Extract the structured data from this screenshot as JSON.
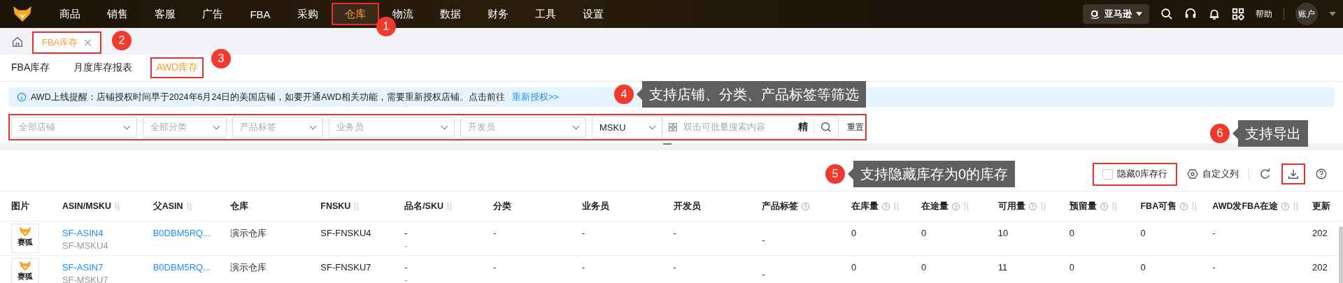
{
  "nav": {
    "items": [
      {
        "label": "商品",
        "selected": false,
        "highlighted": false
      },
      {
        "label": "销售",
        "selected": false,
        "highlighted": false
      },
      {
        "label": "客服",
        "selected": false,
        "highlighted": false
      },
      {
        "label": "广告",
        "selected": false,
        "highlighted": false
      },
      {
        "label": "FBA",
        "selected": false,
        "highlighted": false
      },
      {
        "label": "采购",
        "selected": false,
        "highlighted": false
      },
      {
        "label": "仓库",
        "selected": true,
        "highlighted": true
      },
      {
        "label": "物流",
        "selected": false,
        "highlighted": false
      },
      {
        "label": "数据",
        "selected": false,
        "highlighted": false
      },
      {
        "label": "财务",
        "selected": false,
        "highlighted": false
      },
      {
        "label": "工具",
        "selected": false,
        "highlighted": false
      },
      {
        "label": "设置",
        "selected": false,
        "highlighted": false
      }
    ],
    "marketplace": "亚马逊",
    "help": "帮助",
    "account": "账户"
  },
  "page_tabs": [
    {
      "label": "FBA库存",
      "selected": true,
      "highlighted": true
    }
  ],
  "sub_tabs": [
    {
      "label": "FBA库存",
      "selected": false,
      "highlighted": false
    },
    {
      "label": "月度库存报表",
      "selected": false,
      "highlighted": false
    },
    {
      "label": "AWD库存",
      "selected": true,
      "highlighted": true
    }
  ],
  "notice": {
    "text": "AWD上线提醒：店铺授权时间早于2024年6月24日的美国店铺，如要开通AWD相关功能，需要重新授权店铺。点击前往",
    "link": "重新授权>>"
  },
  "filters": {
    "highlighted": true,
    "selects": [
      {
        "placeholder": "全部店铺"
      },
      {
        "placeholder": "全部分类"
      },
      {
        "placeholder": "产品标签"
      },
      {
        "placeholder": "业务员"
      },
      {
        "placeholder": "开发员"
      }
    ],
    "search_field": {
      "value": "MSKU"
    },
    "search": {
      "placeholder": "双击可批量搜索内容",
      "exact": "精"
    },
    "reset": "重置"
  },
  "toolbar": {
    "hide_zero": {
      "label": "隐藏0库存行",
      "checked": false,
      "highlighted": true
    },
    "columns": "自定义列",
    "export_highlighted": true
  },
  "table": {
    "columns": [
      {
        "label": "图片",
        "sortable": false,
        "help": false
      },
      {
        "label": "ASIN/MSKU",
        "sortable": true,
        "help": false
      },
      {
        "label": "父ASIN",
        "sortable": true,
        "help": false
      },
      {
        "label": "仓库",
        "sortable": false,
        "help": false
      },
      {
        "label": "FNSKU",
        "sortable": true,
        "help": false
      },
      {
        "label": "品名/SKU",
        "sortable": true,
        "help": false
      },
      {
        "label": "分类",
        "sortable": false,
        "help": false
      },
      {
        "label": "业务员",
        "sortable": false,
        "help": false
      },
      {
        "label": "开发员",
        "sortable": false,
        "help": false
      },
      {
        "label": "产品标签",
        "sortable": false,
        "help": true
      },
      {
        "label": "在库量",
        "sortable": true,
        "help": true
      },
      {
        "label": "在途量",
        "sortable": true,
        "help": true
      },
      {
        "label": "可用量",
        "sortable": true,
        "help": true
      },
      {
        "label": "预留量",
        "sortable": true,
        "help": true
      },
      {
        "label": "FBA可售",
        "sortable": true,
        "help": true
      },
      {
        "label": "AWD发FBA在途",
        "sortable": true,
        "help": true
      },
      {
        "label": "更新",
        "sortable": false,
        "help": false
      }
    ],
    "rows": [
      {
        "image_caption": "赛狐",
        "asin": "SF-ASIN4",
        "msku": "SF-MSKU4",
        "parent_asin": "B0DBM5RQ...",
        "warehouse": "演示仓库",
        "fnsku": "SF-FNSKU4",
        "name": "-",
        "sku": "-",
        "category": "-",
        "sales": "-",
        "developer": "-",
        "tags": "-",
        "in_stock": "0",
        "in_transit": "0",
        "available": "10",
        "reserved": "0",
        "fba_sellable": "0",
        "awd_transit": "-",
        "updated": "202"
      },
      {
        "image_caption": "赛狐",
        "asin": "SF-ASIN7",
        "msku": "SF-MSKU7",
        "parent_asin": "B0DBM5RQ...",
        "warehouse": "演示仓库",
        "fnsku": "SF-FNSKU7",
        "name": "-",
        "sku": "-",
        "category": "-",
        "sales": "-",
        "developer": "-",
        "tags": "-",
        "in_stock": "0",
        "in_transit": "0",
        "available": "11",
        "reserved": "0",
        "fba_sellable": "0",
        "awd_transit": "-",
        "updated": "202"
      }
    ]
  },
  "annotations": [
    {
      "number": "1"
    },
    {
      "number": "2"
    },
    {
      "number": "3"
    },
    {
      "number": "4",
      "text": "支持店铺、分类、产品标签等筛选"
    },
    {
      "number": "5",
      "text": "支持隐藏库存为0的库存"
    },
    {
      "number": "6",
      "text": "支持导出"
    }
  ]
}
